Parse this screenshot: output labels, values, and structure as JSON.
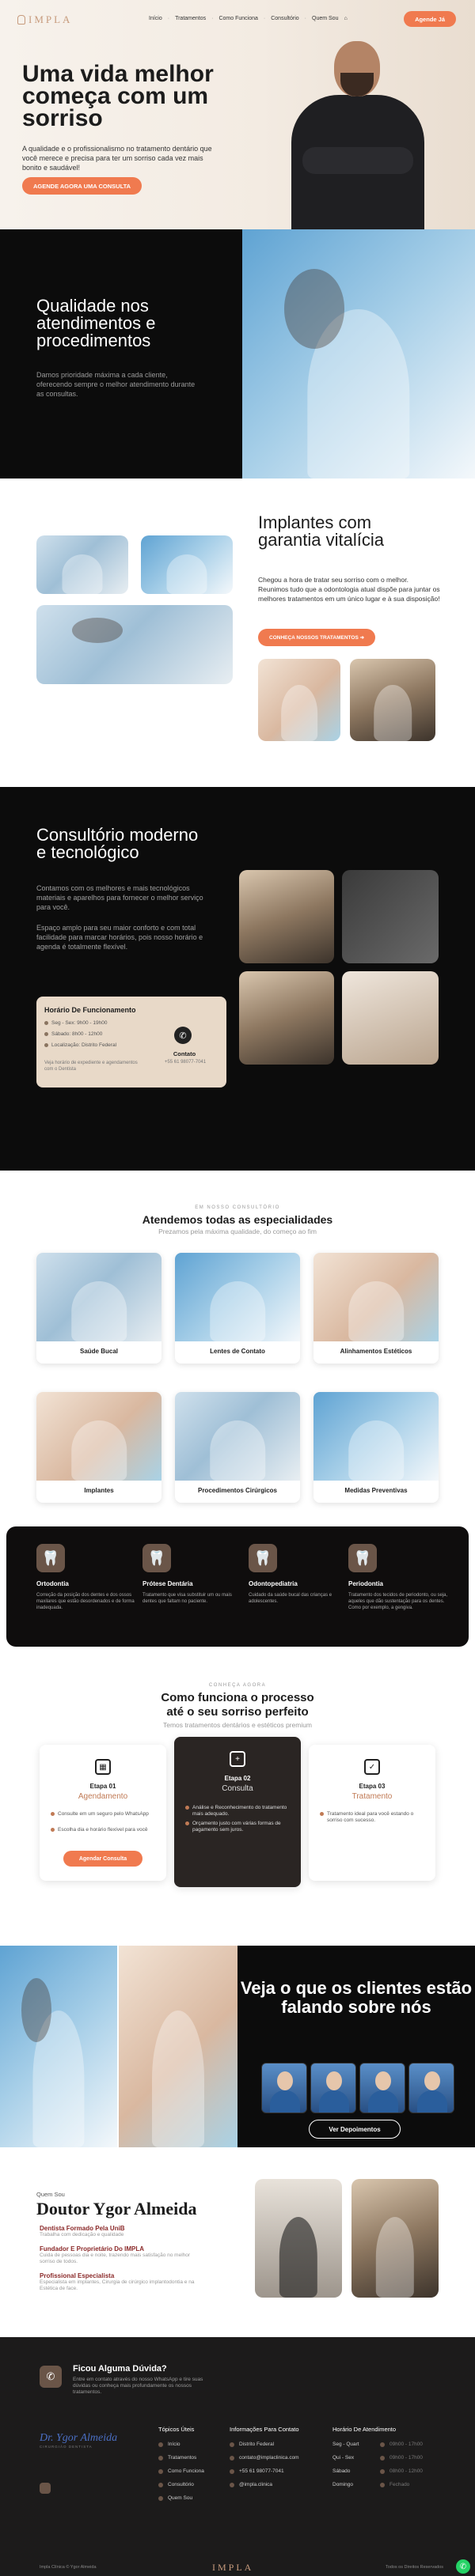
{
  "brand": {
    "logo_text": "IMPLA",
    "accent": "#f07a4f",
    "tan": "#c79b7d"
  },
  "nav": {
    "items": [
      "Início",
      "Tratamentos",
      "Como Funciona",
      "Consultório",
      "Quem Sou"
    ],
    "cta": "Agende Já"
  },
  "hero": {
    "title": "Uma vida melhor começa com um sorriso",
    "text": "A qualidade e o profissionalismo no tratamento dentário que você merece e precisa para ter um sorriso cada vez mais bonito e saudável!",
    "button": "AGENDE AGORA UMA CONSULTA"
  },
  "quality": {
    "title": "Qualidade nos atendimentos e procedimentos",
    "text": "Damos prioridade máxima a cada cliente, oferecendo sempre o melhor atendimento durante as consultas."
  },
  "implants": {
    "title": "Implantes com garantia vitalícia",
    "text": "Chegou a hora de tratar seu sorriso com o melhor. Reunimos tudo que a odontologia atual dispõe para juntar os melhores tratamentos em um único lugar e à sua disposição!",
    "button": "CONHEÇA NOSSOS TRATAMENTOS"
  },
  "consultorio": {
    "title": "Consultório moderno e tecnológico",
    "p1": "Contamos com os melhores e mais tecnológicos materiais e aparelhos para fornecer o melhor serviço para você.",
    "p2": "Espaço amplo para seu maior conforto e com total facilidade para marcar horários, pois nosso horário e agenda é totalmente flexível.",
    "hours": {
      "title": "Horário De Funcionamento",
      "rows": [
        "Seg - Sex: 9h00 - 19h00",
        "Sábado: 8h00 - 12h00",
        "Localização: Distrito Federal"
      ],
      "note": "Veja horário de expediente e agendamentos com o Dentista",
      "contact_label": "Contato",
      "contact_number": "+55 61 98077-7041"
    }
  },
  "specialties": {
    "eyebrow": "EM NOSSO CONSULTÓRIO",
    "title": "Atendemos todas as especialidades",
    "subtitle": "Prezamos pela máxima qualidade, do começo ao fim",
    "items": [
      "Saúde Bucal",
      "Lentes de Contato",
      "Alinhamentos Estéticos",
      "Implantes",
      "Procedimentos Cirúrgicos",
      "Medidas Preventivas"
    ]
  },
  "band": [
    {
      "title": "Ortodontia",
      "text": "Correção da posição dos dentes e dos ossos maxilares que estão desordenados e de forma inadequada."
    },
    {
      "title": "Prótese Dentária",
      "text": "Tratamento que visa substituir um ou mais dentes que faltam no paciente."
    },
    {
      "title": "Odontopediatria",
      "text": "Cuidado da saúde bucal das crianças e adolescentes."
    },
    {
      "title": "Periodontia",
      "text": "Tratamento dos tecidos de periodonto, ou seja, aqueles que dão sustentação para os dentes. Como por exemplo, a gengiva."
    }
  ],
  "process": {
    "eyebrow": "CONHEÇA AGORA",
    "title_line1": "Como funciona o processo",
    "title_line2": "até o seu sorriso perfeito",
    "subtitle": "Temos tratamentos dentários e estéticos premium",
    "steps": [
      {
        "step": "Etapa 01",
        "name": "Agendamento",
        "items": [
          "Consulte em um seguro pelo WhatsApp",
          "Escolha dia e horário flexível para você"
        ],
        "button": "Agendar Consulta"
      },
      {
        "step": "Etapa 02",
        "name": "Consulta",
        "items": [
          "Análise e Reconhecimento do tratamento mais adequado.",
          "Orçamento justo com várias formas de pagamento sem juros."
        ]
      },
      {
        "step": "Etapa 03",
        "name": "Tratamento",
        "items": [
          "Tratamento ideal para você estando o sorriso com sucesso."
        ]
      }
    ]
  },
  "testimonials": {
    "title": "Veja o que os clientes estão falando sobre nós",
    "button": "Ver Depoimentos"
  },
  "about": {
    "eyebrow": "Quem Sou",
    "name": "Doutor Ygor Almeida",
    "items": [
      {
        "title": "Dentista Formado Pela UniB",
        "text": "Trabalha com dedicação e qualidade"
      },
      {
        "title": "Fundador E Proprietário Do IMPLA",
        "text": "Cuida de pessoas dia e noite, trazendo mais satisfação no melhor sorriso de todos."
      },
      {
        "title": "Profissional Especialista",
        "text": "Especialista em implantes, Cirurgia de cirúrgico implantodontia e na Estética de face."
      }
    ]
  },
  "footer": {
    "question": "Ficou Alguma Dúvida?",
    "question_text": "Entre em contato através do nosso WhatsApp e tire suas dúvidas ou conheça mais profundamente os nossos tratamentos.",
    "signature": "Dr. Ygor Almeida",
    "signature_sub": "CIRURGIÃO DENTISTA",
    "col1_title": "Tópicos Úteis",
    "col1": [
      "Início",
      "Tratamentos",
      "Como Funciona",
      "Consultório",
      "Quem Sou"
    ],
    "col2_title": "Informações Para Contato",
    "col2": [
      "Distrito Federal",
      "contato@implaclinica.com",
      "+55 61 98077-7041",
      "@impla.clinica"
    ],
    "col3_title": "Horário De Atendimento",
    "col3": [
      {
        "day": "Seg - Quart",
        "time": "09h00 - 17h00"
      },
      {
        "day": "Qui - Sex",
        "time": "09h00 - 17h00"
      },
      {
        "day": "Sábado",
        "time": "08h00 - 12h00"
      },
      {
        "day": "Domingo",
        "time": "Fechado"
      }
    ],
    "bottom_left": "Impla Clínica © Ygor Almeida",
    "bottom_right": "Todos os Direitos Reservados"
  }
}
